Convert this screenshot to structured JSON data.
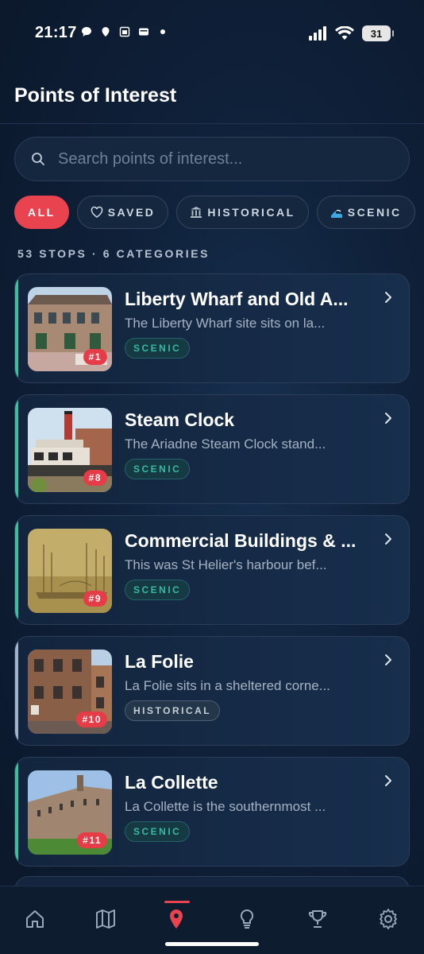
{
  "status": {
    "time": "21:17",
    "battery": "31",
    "left_icons": [
      "chat-bubble-icon",
      "location-pin-icon",
      "calendar-icon",
      "wallet-icon",
      "dot-icon"
    ],
    "right_icons": [
      "signal-icon",
      "wifi-icon",
      "battery-icon"
    ]
  },
  "header": {
    "title": "Points of Interest"
  },
  "search": {
    "placeholder": "Search points of interest..."
  },
  "filters": [
    {
      "label": "ALL",
      "icon": "",
      "active": true
    },
    {
      "label": "SAVED",
      "icon": "heart-icon",
      "active": false
    },
    {
      "label": "HISTORICAL",
      "icon": "museum-icon",
      "active": false
    },
    {
      "label": "SCENIC",
      "icon": "wave-icon",
      "active": false
    }
  ],
  "summary": "53 STOPS · 6 CATEGORIES",
  "colors": {
    "accent": "#e8434f",
    "scenic": "#39b9a4",
    "background": "#0f2039"
  },
  "cards": [
    {
      "title": "Liberty Wharf and Old A...",
      "description": "The Liberty Wharf site sits on la...",
      "tag": "SCENIC",
      "number": "#1"
    },
    {
      "title": "Steam Clock",
      "description": "The Ariadne Steam Clock stand...",
      "tag": "SCENIC",
      "number": "#8"
    },
    {
      "title": "Commercial Buildings & ...",
      "description": "This was St Helier's harbour bef...",
      "tag": "SCENIC",
      "number": "#9"
    },
    {
      "title": "La Folie",
      "description": "La Folie sits in a sheltered corne...",
      "tag": "HISTORICAL",
      "number": "#10"
    },
    {
      "title": "La Collette",
      "description": "La Collette is the southernmost ...",
      "tag": "SCENIC",
      "number": "#11"
    }
  ],
  "nav": [
    {
      "name": "home-icon",
      "active": false
    },
    {
      "name": "map-icon",
      "active": false
    },
    {
      "name": "location-pin-icon",
      "active": true
    },
    {
      "name": "lightbulb-icon",
      "active": false
    },
    {
      "name": "trophy-icon",
      "active": false
    },
    {
      "name": "settings-gear-icon",
      "active": false
    }
  ]
}
